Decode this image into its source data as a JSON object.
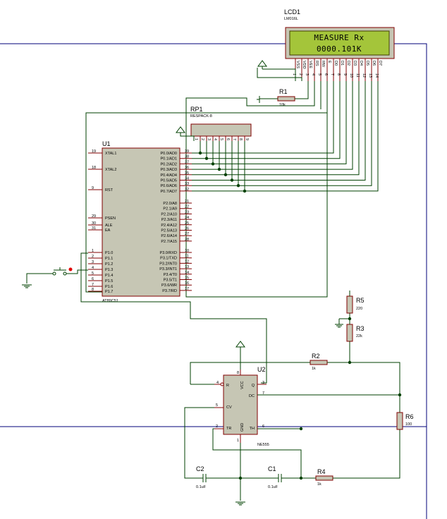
{
  "components": {
    "lcd": {
      "ref": "LCD1",
      "part": "LM016L",
      "line1": "MEASURE Rx",
      "line2": "0000.101K",
      "pins": [
        "VSS",
        "VDD",
        "VEE",
        "RS",
        "RW",
        "E",
        "D0",
        "D1",
        "D2",
        "D3",
        "D4",
        "D5",
        "D6",
        "D7"
      ],
      "pin_numbers": [
        "1",
        "2",
        "3",
        "4",
        "5",
        "6",
        "7",
        "8",
        "9",
        "10",
        "11",
        "12",
        "13",
        "14"
      ]
    },
    "rp1": {
      "ref": "RP1",
      "part": "RESPACK-8"
    },
    "u1": {
      "ref": "U1",
      "part": "AT89C51",
      "left_pins": [
        {
          "num": "19",
          "name": "XTAL1"
        },
        {
          "num": "18",
          "name": "XTAL2"
        },
        {
          "num": "9",
          "name": "RST"
        },
        {
          "num": "29",
          "name": "PSEN"
        },
        {
          "num": "30",
          "name": "ALE"
        },
        {
          "num": "31",
          "name": "EA"
        },
        {
          "num": "1",
          "name": "P1.0"
        },
        {
          "num": "2",
          "name": "P1.1"
        },
        {
          "num": "3",
          "name": "P1.2"
        },
        {
          "num": "4",
          "name": "P1.3"
        },
        {
          "num": "5",
          "name": "P1.4"
        },
        {
          "num": "6",
          "name": "P1.5"
        },
        {
          "num": "7",
          "name": "P1.6"
        },
        {
          "num": "8",
          "name": "P1.7"
        }
      ],
      "right_pins": [
        {
          "num": "39",
          "name": "P0.0/AD0"
        },
        {
          "num": "38",
          "name": "P0.1/AD1"
        },
        {
          "num": "37",
          "name": "P0.2/AD2"
        },
        {
          "num": "36",
          "name": "P0.3/AD3"
        },
        {
          "num": "35",
          "name": "P0.4/AD4"
        },
        {
          "num": "34",
          "name": "P0.5/AD5"
        },
        {
          "num": "33",
          "name": "P0.6/AD6"
        },
        {
          "num": "32",
          "name": "P0.7/AD7"
        },
        {
          "num": "21",
          "name": "P2.0/A8"
        },
        {
          "num": "22",
          "name": "P2.1/A9"
        },
        {
          "num": "23",
          "name": "P2.2/A10"
        },
        {
          "num": "24",
          "name": "P2.3/A11"
        },
        {
          "num": "25",
          "name": "P2.4/A12"
        },
        {
          "num": "26",
          "name": "P2.5/A13"
        },
        {
          "num": "27",
          "name": "P2.6/A14"
        },
        {
          "num": "28",
          "name": "P2.7/A15"
        },
        {
          "num": "10",
          "name": "P3.0/RXD"
        },
        {
          "num": "11",
          "name": "P3.1/TXD"
        },
        {
          "num": "12",
          "name": "P3.2/INT0"
        },
        {
          "num": "13",
          "name": "P3.3/INT1"
        },
        {
          "num": "14",
          "name": "P3.4/T0"
        },
        {
          "num": "15",
          "name": "P3.5/T1"
        },
        {
          "num": "16",
          "name": "P3.6/WR"
        },
        {
          "num": "17",
          "name": "P3.7/RD"
        }
      ]
    },
    "u2": {
      "ref": "U2",
      "part": "NE555",
      "pins": {
        "r": "R",
        "vcc": "VCC",
        "dc": "DC",
        "cv": "CV",
        "q": "Q",
        "tr": "TR",
        "gnd": "GND",
        "th": "TH"
      },
      "nums": {
        "r": "4",
        "vcc": "8",
        "q": "3",
        "dc": "7",
        "cv": "5",
        "tr": "2",
        "gnd": "1",
        "th": "6"
      }
    },
    "r1": {
      "ref": "R1",
      "value": "10k"
    },
    "r2": {
      "ref": "R2",
      "value": "1k"
    },
    "r3": {
      "ref": "R3",
      "value": "22k"
    },
    "r4": {
      "ref": "R4",
      "value": "1k"
    },
    "r5": {
      "ref": "R5",
      "value": "220"
    },
    "r6": {
      "ref": "R6",
      "value": "100"
    },
    "c1": {
      "ref": "C1",
      "value": "0.1uF"
    },
    "c2": {
      "ref": "C2",
      "value": "0.1uF"
    }
  },
  "colors": {
    "wire": "#004000",
    "body": "#c6c6b4",
    "outline": "#800000",
    "lcd_screen": "#a4c53a",
    "sheet": "#00007a"
  }
}
